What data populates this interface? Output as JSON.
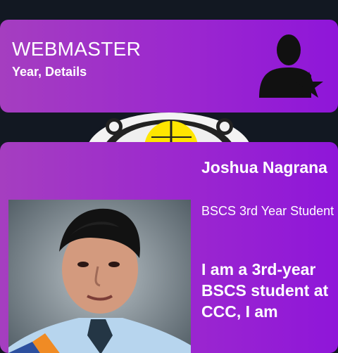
{
  "role_card": {
    "title": "WEBMASTER",
    "subtitle": "Year, Details",
    "icon": "user-star-icon"
  },
  "emblem": {
    "icon": "school-logo-icon"
  },
  "profile": {
    "name": "Joshua Nagrana",
    "program": "BSCS 3rd Year Student",
    "bio": "I am a 3rd-year BSCS student at CCC, I am"
  },
  "colors": {
    "background": "#121822",
    "card_gradient_start": "#a53ec0",
    "card_gradient_end": "#8f16d9",
    "icon_color": "#111111",
    "text": "#ffffff"
  }
}
